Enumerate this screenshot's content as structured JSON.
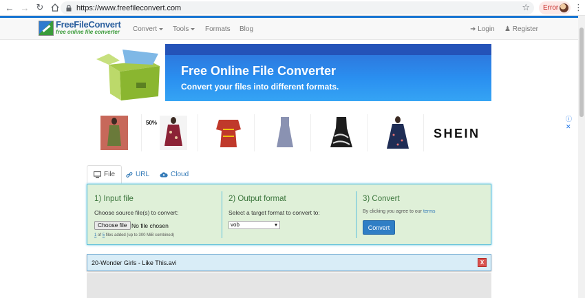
{
  "browser": {
    "url": "https://www.freefileconvert.com",
    "error_badge": "Error"
  },
  "logo": {
    "name": "FreeFileConvert",
    "tagline": "free online file converter"
  },
  "nav": {
    "convert": "Convert",
    "tools": "Tools",
    "formats": "Formats",
    "blog": "Blog",
    "login": "Login",
    "register": "Register"
  },
  "banner": {
    "title": "Free Online File Converter",
    "subtitle": "Convert your files into different formats."
  },
  "ad": {
    "discount": "50%",
    "brand": "SHEIN",
    "info_icon": "info-icon",
    "close": "✕"
  },
  "tabs": [
    {
      "label": "File",
      "icon": "monitor-icon"
    },
    {
      "label": "URL",
      "icon": "link-icon"
    },
    {
      "label": "Cloud",
      "icon": "cloud-icon"
    }
  ],
  "converter": {
    "step1_title": "1) Input file",
    "step1_text": "Choose source file(s) to convert:",
    "choose_file": "Choose file",
    "no_file": "No file chosen",
    "files_count": "1",
    "files_of": "of",
    "files_max": "5",
    "files_note": "files added (up to 300 MiB combined)",
    "step2_title": "2) Output format",
    "step2_text": "Select a target format to convert to:",
    "format_selected": "vob",
    "step3_title": "3) Convert",
    "step3_text": "By clicking you agree to our",
    "terms": "terms",
    "convert_button": "Convert"
  },
  "file_bar": {
    "filename": "20-Wonder Girls - Like This.avi",
    "remove": "X"
  },
  "colors": {
    "accent_blue": "#1976d2",
    "panel_green": "#dff0d8",
    "heading_green": "#3c763d",
    "button_blue": "#2f7ec5",
    "danger_red": "#d9534f",
    "file_bar_blue": "#d9edf7"
  }
}
